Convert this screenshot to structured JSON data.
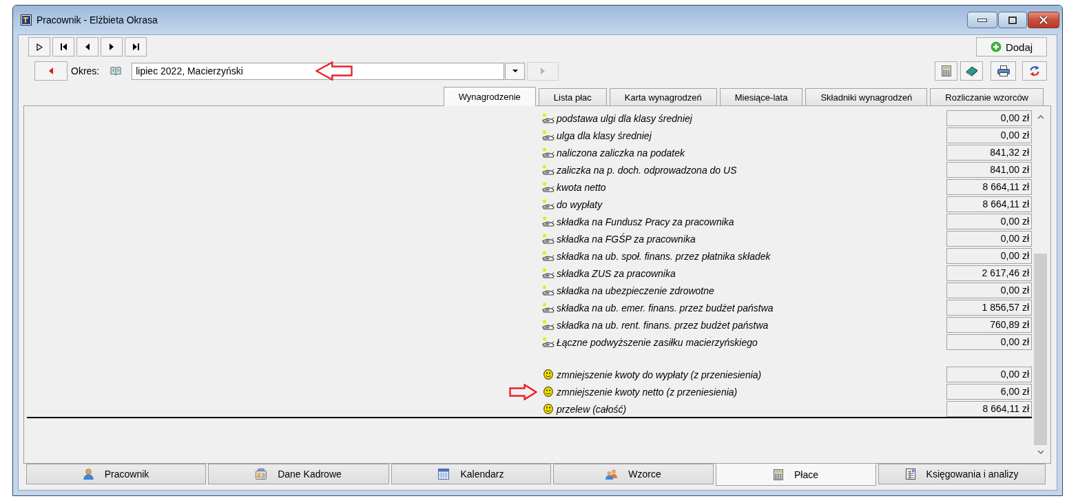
{
  "window": {
    "title": "Pracownik - Elżbieta Okrasa"
  },
  "period": {
    "label": "Okres:",
    "value": "lipiec 2022, Macierzyński",
    "arrow_marked": true,
    "buttons": [
      {
        "kind": "prev",
        "disabled": false
      },
      {
        "kind": "next",
        "disabled": true
      }
    ]
  },
  "add_button": {
    "label": "Dodaj"
  },
  "tabs": [
    {
      "label": "Wynagrodzenie",
      "selected": true
    },
    {
      "label": "Lista płac",
      "selected": false
    },
    {
      "label": "Karta wynagrodzeń",
      "selected": false
    },
    {
      "label": "Miesiące-lata",
      "selected": false
    },
    {
      "label": "Składniki wynagrodzeń",
      "selected": false
    },
    {
      "label": "Rozliczanie wzorców",
      "selected": false
    }
  ],
  "sections": [
    {
      "rows": [
        {
          "kind": "hand",
          "label": "podstawa ulgi dla klasy średniej",
          "value": "0,00 zł",
          "arrow_marked": false
        },
        {
          "kind": "hand",
          "label": "ulga dla klasy średniej",
          "value": "0,00 zł",
          "arrow_marked": false
        },
        {
          "kind": "hand",
          "label": "naliczona zaliczka na podatek",
          "value": "841,32 zł",
          "arrow_marked": false
        },
        {
          "kind": "hand",
          "label": "zaliczka na p. doch. odprowadzona do US",
          "value": "841,00 zł",
          "arrow_marked": false
        },
        {
          "kind": "hand",
          "label": "kwota netto",
          "value": "8 664,11 zł",
          "arrow_marked": false
        },
        {
          "kind": "hand",
          "label": "do wypłaty",
          "value": "8 664,11 zł",
          "arrow_marked": false
        },
        {
          "kind": "hand",
          "label": "składka na Fundusz Pracy za pracownika",
          "value": "0,00 zł",
          "arrow_marked": false
        },
        {
          "kind": "hand",
          "label": "składka na FGŚP za pracownika",
          "value": "0,00 zł",
          "arrow_marked": false
        },
        {
          "kind": "hand",
          "label": "składka na ub. społ. finans. przez płatnika składek",
          "value": "0,00 zł",
          "arrow_marked": false
        },
        {
          "kind": "hand",
          "label": "składka ZUS za pracownika",
          "value": "2 617,46 zł",
          "arrow_marked": false
        },
        {
          "kind": "hand",
          "label": "składka na ubezpieczenie zdrowotne",
          "value": "0,00 zł",
          "arrow_marked": false
        },
        {
          "kind": "hand",
          "label": "składka na ub. emer. finans. przez budżet państwa",
          "value": "1 856,57 zł",
          "arrow_marked": false
        },
        {
          "kind": "hand",
          "label": "składka na ub. rent. finans. przez budżet państwa",
          "value": "760,89 zł",
          "arrow_marked": false
        },
        {
          "kind": "hand",
          "label": "Łączne podwyższenie zasiłku macierzyńskiego",
          "value": "0,00 zł",
          "arrow_marked": false
        }
      ]
    },
    {
      "rows": [
        {
          "kind": "smiley",
          "label": "zmniejszenie kwoty do wypłaty (z przeniesienia)",
          "value": "0,00 zł",
          "arrow_marked": false
        },
        {
          "kind": "smiley",
          "label": "zmniejszenie kwoty netto (z przeniesienia)",
          "value": "6,00 zł",
          "arrow_marked": true
        },
        {
          "kind": "smiley",
          "label": "przelew (całość)",
          "value": "8 664,11 zł",
          "arrow_marked": false
        }
      ]
    }
  ],
  "bottom_tabs": [
    {
      "label": "Pracownik",
      "selected": false
    },
    {
      "label": "Dane Kadrowe",
      "selected": false
    },
    {
      "label": "Kalendarz",
      "selected": false
    },
    {
      "label": "Wzorce",
      "selected": false
    },
    {
      "label": "Płace",
      "selected": true
    },
    {
      "label": "Księgowania i analizy",
      "selected": false
    }
  ]
}
